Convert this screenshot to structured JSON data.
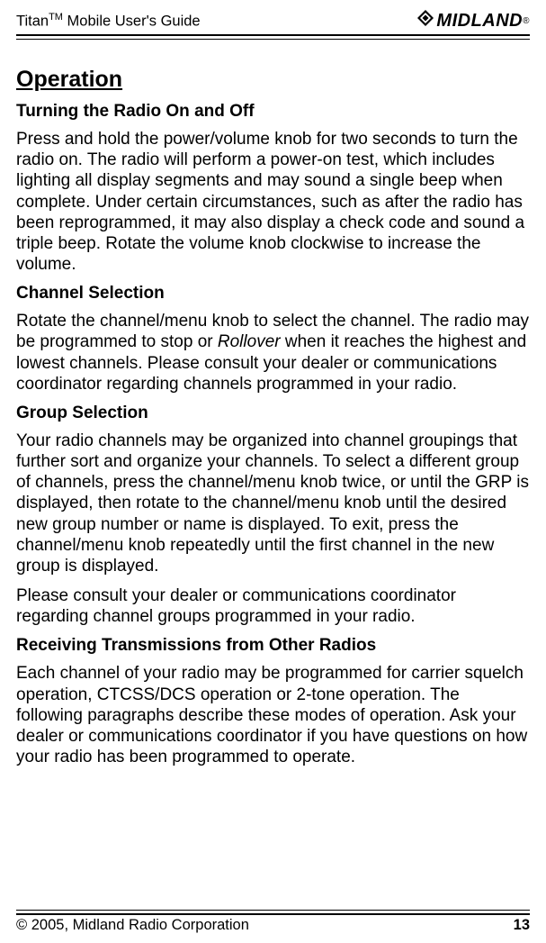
{
  "header": {
    "title_prefix": "Titan",
    "title_tm": "TM",
    "title_suffix": " Mobile User's Guide",
    "logo_text": "MIDLAND",
    "logo_reg": "®"
  },
  "content": {
    "section_title": "Operation",
    "sub1_title": "Turning the Radio On and Off",
    "sub1_body": "Press and hold the power/volume knob for two seconds to turn the radio on. The radio will perform a power-on test, which includes lighting all display segments and may sound a single beep when complete. Under certain circumstances, such as after the radio has been reprogrammed, it may also display a check code and sound a triple beep. Rotate the volume knob clockwise to increase the volume.",
    "sub2_title": "Channel Selection",
    "sub2_body_a": "Rotate the channel/menu knob to select the channel. The radio may be programmed to stop or ",
    "sub2_body_italic": "Rollover",
    "sub2_body_b": " when it reaches the highest and lowest channels. Please consult your dealer or communications coordinator regarding channels programmed in your radio.",
    "sub3_title": "Group Selection",
    "sub3_body1": "Your radio channels may be organized into channel groupings that further sort and organize your channels. To select a different group of channels, press the channel/menu knob twice, or until the GRP is displayed, then rotate to the channel/menu knob until the desired new group number or name is displayed. To exit, press the channel/menu knob repeatedly until the first channel in the new group is displayed.",
    "sub3_body2": "Please consult your dealer or communications coordinator regarding channel groups programmed in your radio.",
    "sub4_title": "Receiving Transmissions from Other Radios",
    "sub4_body": "Each channel of your radio may be programmed for carrier squelch operation, CTCSS/DCS operation or 2-tone operation. The following paragraphs describe these modes of operation. Ask your dealer or communications coordinator if you have questions on how your radio has been programmed to operate."
  },
  "footer": {
    "copyright": "© 2005, Midland Radio Corporation",
    "page_number": "13"
  }
}
